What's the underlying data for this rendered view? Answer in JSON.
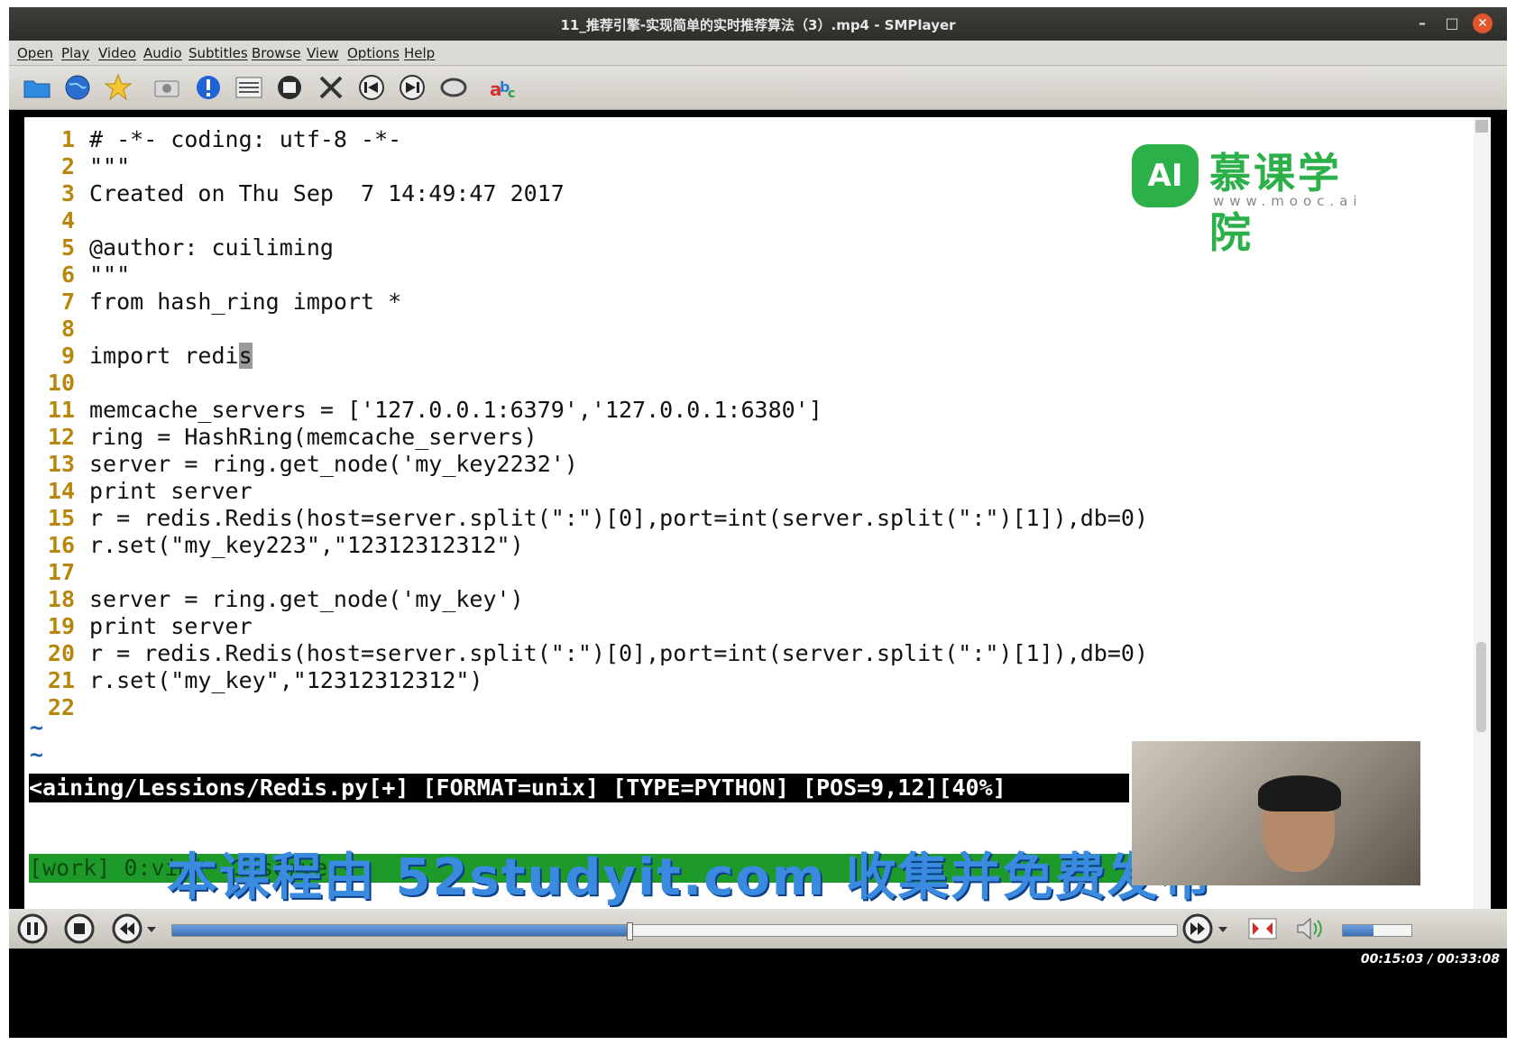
{
  "window": {
    "title": "11_推荐引擎-实现简单的实时推荐算法（3）.mp4 - SMPlayer",
    "minimize": "–",
    "maximize": "□",
    "close": "✕"
  },
  "menu": [
    "Open",
    "Play",
    "Video",
    "Audio",
    "Subtitles",
    "Browse",
    "View",
    "Options",
    "Help"
  ],
  "toolbar_icons": [
    "open-folder-icon",
    "globe-icon",
    "favorites-star-icon",
    "screenshot-camera-icon",
    "info-icon",
    "playlist-icon",
    "video-settings-icon",
    "preferences-tools-icon",
    "previous-icon",
    "next-icon",
    "repeat-ab-icon",
    "subtitles-abc-icon"
  ],
  "editor": {
    "lines": [
      {
        "n": "1",
        "text": "# -*- coding: utf-8 -*-"
      },
      {
        "n": "2",
        "text": "\"\"\""
      },
      {
        "n": "3",
        "text": "Created on Thu Sep  7 14:49:47 2017"
      },
      {
        "n": "4",
        "text": ""
      },
      {
        "n": "5",
        "text": "@author: cuiliming"
      },
      {
        "n": "6",
        "text": "\"\"\""
      },
      {
        "n": "7",
        "text": "from hash_ring import *"
      },
      {
        "n": "8",
        "text": ""
      },
      {
        "n": "9",
        "text": "import redi",
        "cursor": "s"
      },
      {
        "n": "10",
        "text": ""
      },
      {
        "n": "11",
        "text": "memcache_servers = ['127.0.0.1:6379','127.0.0.1:6380']"
      },
      {
        "n": "12",
        "text": "ring = HashRing(memcache_servers)"
      },
      {
        "n": "13",
        "text": "server = ring.get_node('my_key2232')"
      },
      {
        "n": "14",
        "text": "print server"
      },
      {
        "n": "15",
        "text": "r = redis.Redis(host=server.split(\":\")[0],port=int(server.split(\":\")[1]),db=0)"
      },
      {
        "n": "16",
        "text": "r.set(\"my_key223\",\"12312312312\")"
      },
      {
        "n": "17",
        "text": ""
      },
      {
        "n": "18",
        "text": "server = ring.get_node('my_key')"
      },
      {
        "n": "19",
        "text": "print server"
      },
      {
        "n": "20",
        "text": "r = redis.Redis(host=server.split(\":\")[0],port=int(server.split(\":\")[1]),db=0)"
      },
      {
        "n": "21",
        "text": "r.set(\"my_key\",\"12312312312\")"
      },
      {
        "n": "22",
        "text": ""
      }
    ],
    "tilde": "~",
    "statusline": "<aining/Lessions/Redis.py[+] [FORMAT=unix] [TYPE=PYTHON] [POS=9,12][40%]",
    "tmux": "[work] 0:vim*  1:server-"
  },
  "logo": {
    "badge": "AI",
    "brand": "慕课学院",
    "url": "www.mooc.ai"
  },
  "watermark": "本课程由 52studyit.com 收集并免费发布",
  "player": {
    "progress": 0.452,
    "volume": 0.45,
    "time": "00:15:03 / 00:33:08"
  }
}
